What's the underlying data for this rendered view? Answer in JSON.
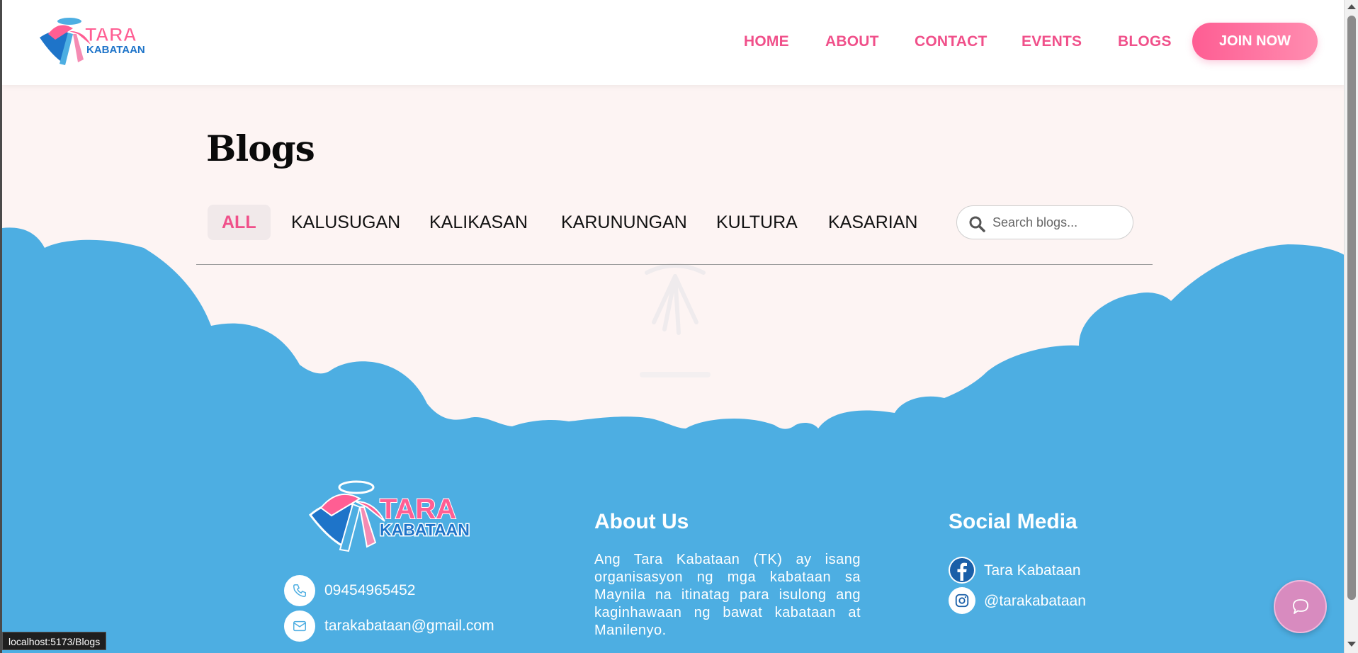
{
  "nav": {
    "logo_text_top": "TARA",
    "logo_text_bottom": "KABATAAN",
    "links": [
      "HOME",
      "ABOUT",
      "CONTACT",
      "EVENTS",
      "BLOGS"
    ],
    "join_label": "JOIN NOW"
  },
  "blogs": {
    "title": "Blogs",
    "categories": [
      "ALL",
      "KALUSUGAN",
      "KALIKASAN",
      "KARUNUNGAN",
      "KULTURA",
      "KASARIAN"
    ],
    "active_category": "ALL",
    "search_placeholder": "Search blogs..."
  },
  "footer": {
    "phone": "09454965452",
    "email": "tarakabataan@gmail.com",
    "about_heading": "About Us",
    "about_text": "Ang Tara Kabataan (TK) ay isang organisasyon ng mga kabataan sa Maynila na itinatag para isulong ang kaginhawaan ng bawat kabataan at Manilenyo.",
    "social_heading": "Social Media",
    "facebook": "Tara Kabataan",
    "instagram": "@tarakabataan"
  },
  "status_bar": {
    "url": "localhost:5173/Blogs"
  },
  "colors": {
    "accent_pink": "#f0508a",
    "cloud_blue": "#4daee2",
    "page_bg": "#fdf4f3"
  },
  "icons": {
    "search": "search-icon",
    "phone": "phone-icon",
    "email": "mail-icon",
    "facebook": "facebook-icon",
    "instagram": "instagram-icon",
    "chat": "chat-icon"
  }
}
